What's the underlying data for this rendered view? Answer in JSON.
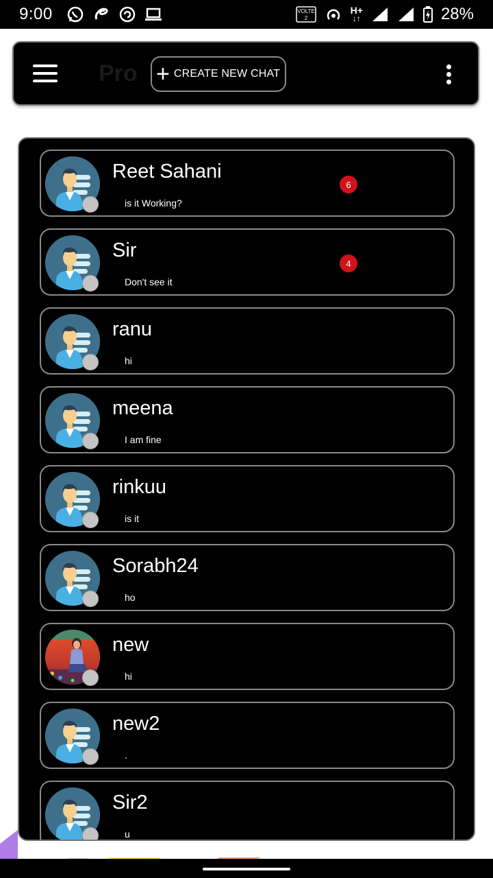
{
  "status_bar": {
    "time": "9:00",
    "battery_percent": "28%",
    "network_label": "H+",
    "volte_label": "VOLTE",
    "sim_label": "2",
    "left_icons": [
      "whatsapp-icon",
      "airtel-icon",
      "sync-icon",
      "laptop-icon"
    ],
    "right_icons": [
      "volte-icon",
      "hotspot-icon",
      "h-plus-icon",
      "signal-icon",
      "signal-icon",
      "battery-charging-icon"
    ]
  },
  "app_bar": {
    "title": "Pro",
    "create_chat_label": "CREATE NEW CHAT",
    "menu_icon": "hamburger-menu-icon",
    "more_icon": "more-vertical-icon"
  },
  "chats": [
    {
      "name": "Reet Sahani",
      "preview": "is it Working?",
      "unread": "6",
      "avatar": "default"
    },
    {
      "name": "Sir",
      "preview": "Don't see it",
      "unread": "4",
      "avatar": "default"
    },
    {
      "name": "ranu",
      "preview": "hi",
      "unread": "",
      "avatar": "default"
    },
    {
      "name": "meena",
      "preview": "I am fine",
      "unread": "",
      "avatar": "default"
    },
    {
      "name": "rinkuu",
      "preview": "is it",
      "unread": "",
      "avatar": "default"
    },
    {
      "name": "Sorabh24",
      "preview": "ho",
      "unread": "",
      "avatar": "default"
    },
    {
      "name": "new",
      "preview": "hi",
      "unread": "",
      "avatar": "photo"
    },
    {
      "name": "new2",
      "preview": ".",
      "unread": "",
      "avatar": "default"
    },
    {
      "name": "Sir2",
      "preview": "u",
      "unread": "",
      "avatar": "default"
    }
  ],
  "colors": {
    "background": "#ffffff",
    "panel": "#000000",
    "border": "#8a8a8a",
    "badge": "#d0121b",
    "avatar_bg": "#3e708c",
    "status_dot": "#c4c4c4"
  }
}
